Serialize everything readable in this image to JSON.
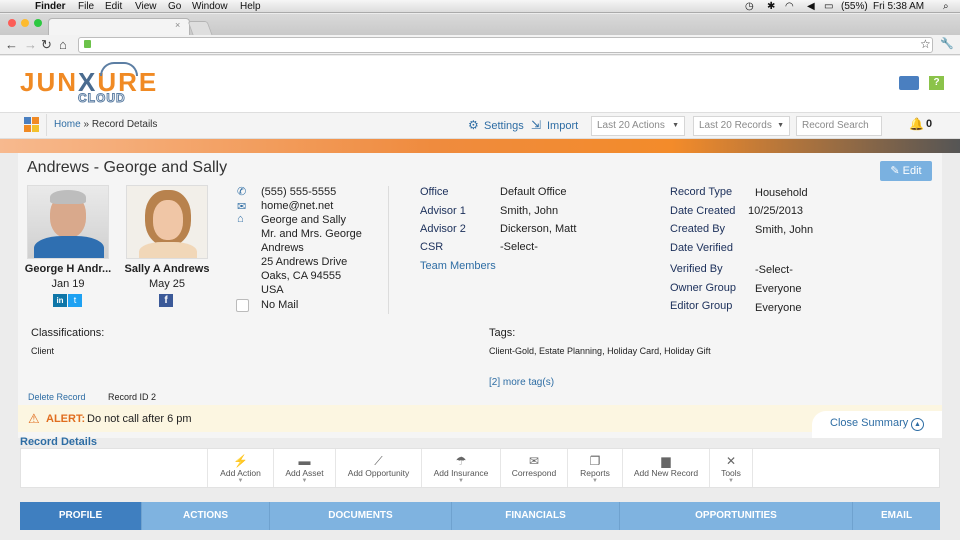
{
  "menubar": {
    "app": "Finder",
    "items": [
      "File",
      "Edit",
      "View",
      "Go",
      "Window",
      "Help"
    ],
    "battery": "(55%)",
    "clock": "Fri 5:38 AM"
  },
  "header": {
    "logo_top_a": "JUN",
    "logo_top_b": "X",
    "logo_top_c": "URE",
    "logo_bottom": "CLOUD"
  },
  "nav": {
    "breadcrumb_home": "Home",
    "breadcrumb_sep": " » ",
    "breadcrumb_current": "Record Details",
    "settings": "Settings",
    "import": "Import",
    "last_actions": "Last 20 Actions",
    "last_records": "Last 20 Records",
    "search_placeholder": "Record Search",
    "notif_count": "0"
  },
  "record": {
    "title": "Andrews - George and Sally",
    "edit": "Edit",
    "person1": {
      "name": "George H Andr...",
      "date": "Jan 19"
    },
    "person2": {
      "name": "Sally A Andrews",
      "date": "May 25"
    },
    "phone": "(555) 555-5555",
    "email": "home@net.net",
    "address": [
      "George and Sally",
      "Mr. and Mrs. George",
      "Andrews",
      "25 Andrews Drive",
      "Oaks, CA 94555",
      "USA"
    ],
    "no_mail": "No Mail",
    "office_label": "Office",
    "office": "Default Office",
    "advisor1_label": "Advisor 1",
    "advisor1": "Smith, John",
    "advisor2_label": "Advisor 2",
    "advisor2": "Dickerson, Matt",
    "csr_label": "CSR",
    "csr": "-Select-",
    "team_members": "Team Members",
    "record_type_label": "Record Type",
    "record_type": "Household",
    "date_created_label": "Date Created",
    "date_created": "10/25/2013",
    "created_by_label": "Created By",
    "created_by": "Smith, John",
    "date_verified_label": "Date Verified",
    "verified_by_label": "Verified By",
    "verified_by": "-Select-",
    "owner_group_label": "Owner Group",
    "owner_group": "Everyone",
    "editor_group_label": "Editor Group",
    "editor_group": "Everyone",
    "classifications_label": "Classifications:",
    "classifications": "Client",
    "tags_label": "Tags:",
    "tags": "Client-Gold, Estate Planning, Holiday Card, Holiday Gift",
    "more_tags": "[2] more tag(s)",
    "delete": "Delete Record",
    "record_id": "Record ID 2",
    "alert_label": "ALERT:",
    "alert_text": "Do not call after 6 pm",
    "close_summary": "Close Summary"
  },
  "section_title": "Record Details",
  "actions": [
    "Add Action",
    "Add Asset",
    "Add Opportunity",
    "Add Insurance",
    "Correspond",
    "Reports",
    "Add New Record",
    "Tools"
  ],
  "tabs": [
    "PROFILE",
    "ACTIONS",
    "DOCUMENTS",
    "FINANCIALS",
    "OPPORTUNITIES",
    "EMAIL"
  ],
  "colors": {
    "accent": "#2e6da4",
    "orange": "#f08a24",
    "tab": "#7fb3e0",
    "tab_active": "#3f7fc0"
  }
}
